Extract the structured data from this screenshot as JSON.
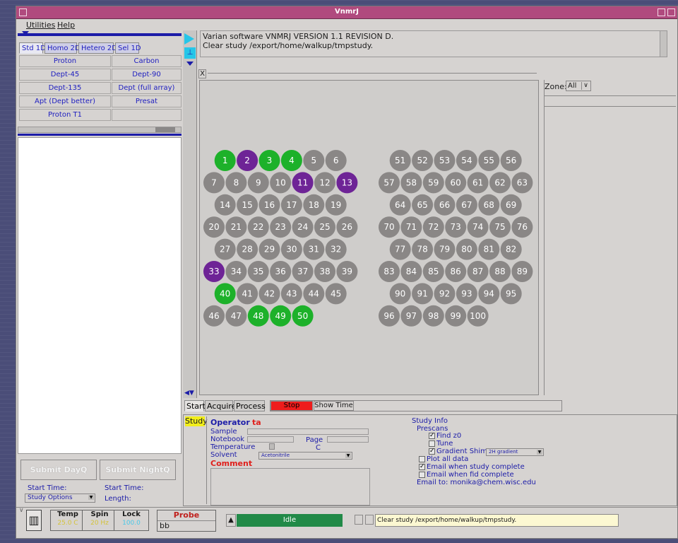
{
  "window": {
    "title": "VnmrJ"
  },
  "menu": {
    "items": [
      "Utilities",
      "Help"
    ]
  },
  "experiment_tabs": [
    "Std 1D",
    "Homo 2D",
    "Hetero 2D",
    "Sel 1D"
  ],
  "protocols": [
    [
      "Proton",
      "Carbon"
    ],
    [
      "Dept-45",
      "Dept-90"
    ],
    [
      "Dept-135",
      "Dept (full array)"
    ],
    [
      "Apt (Dept better)",
      "Presat"
    ],
    [
      "Proton T1",
      ""
    ]
  ],
  "messages": [
    "Varian software VNMRJ VERSION 1.1 REVISION D.",
    "Clear study /export/home/walkup/tmpstudy."
  ],
  "x_button": "X",
  "zone": {
    "label": "Zone:",
    "value": "All"
  },
  "tray": {
    "done_slots": [
      1,
      3,
      4,
      40,
      48,
      49,
      50
    ],
    "queued_slots": [
      2,
      11,
      13,
      33
    ],
    "left_rows": [
      [
        1,
        2,
        3,
        4,
        5,
        6
      ],
      [
        7,
        8,
        9,
        10,
        11,
        12,
        13
      ],
      [
        14,
        15,
        16,
        17,
        18,
        19
      ],
      [
        20,
        21,
        22,
        23,
        24,
        25,
        26
      ],
      [
        27,
        28,
        29,
        30,
        31,
        32
      ],
      [
        33,
        34,
        35,
        36,
        37,
        38,
        39
      ],
      [
        40,
        41,
        42,
        43,
        44,
        45
      ],
      [
        46,
        47,
        48,
        49,
        50
      ]
    ],
    "right_rows": [
      [
        51,
        52,
        53,
        54,
        55,
        56
      ],
      [
        57,
        58,
        59,
        60,
        61,
        62,
        63
      ],
      [
        64,
        65,
        66,
        67,
        68,
        69
      ],
      [
        70,
        71,
        72,
        73,
        74,
        75,
        76
      ],
      [
        77,
        78,
        79,
        80,
        81,
        82
      ],
      [
        83,
        84,
        85,
        86,
        87,
        88,
        89
      ],
      [
        90,
        91,
        92,
        93,
        94,
        95
      ],
      [
        96,
        97,
        98,
        99,
        100
      ]
    ]
  },
  "action_tabs": [
    "Start",
    "Acquire",
    "Process"
  ],
  "stop_label": "Stop",
  "show_time_label": "Show Time",
  "study_tab": "Study",
  "form": {
    "operator_label": "Operator",
    "operator_value": "ta",
    "sample_label": "Sample",
    "notebook_label": "Notebook",
    "page_label": "Page",
    "temperature_label": "Temperature",
    "temperature_unit": "C",
    "solvent_label": "Solvent",
    "solvent_value": "Acetonitrile",
    "comment_label": "Comment"
  },
  "study_info": {
    "title": "Study Info",
    "prescans": "Prescans",
    "find_z0": "Find z0",
    "tune": "Tune",
    "gradient_shim": "Gradient Shim",
    "gradient_value": "2H gradient",
    "plot_all": "Plot all data",
    "email_study": "Email when study complete",
    "email_fid": "Email when fid complete",
    "email_to": "Email to: monika@chem.wisc.edu"
  },
  "submit": {
    "day": "Submit DayQ",
    "night": "Submit NightQ",
    "start_time_1": "Start Time:",
    "start_time_2": "Start Time:",
    "study_options": "Study Options",
    "length": "Length:"
  },
  "status": {
    "temp": "Temp",
    "temp_value": "25.0 C",
    "spin": "Spin",
    "spin_value": "20 Hz",
    "lock": "Lock",
    "lock_value": "100.0",
    "probe_label": "Probe",
    "probe_value": "bb",
    "state": "Idle",
    "last_message": "Clear study /export/home/walkup/tmpstudy."
  }
}
